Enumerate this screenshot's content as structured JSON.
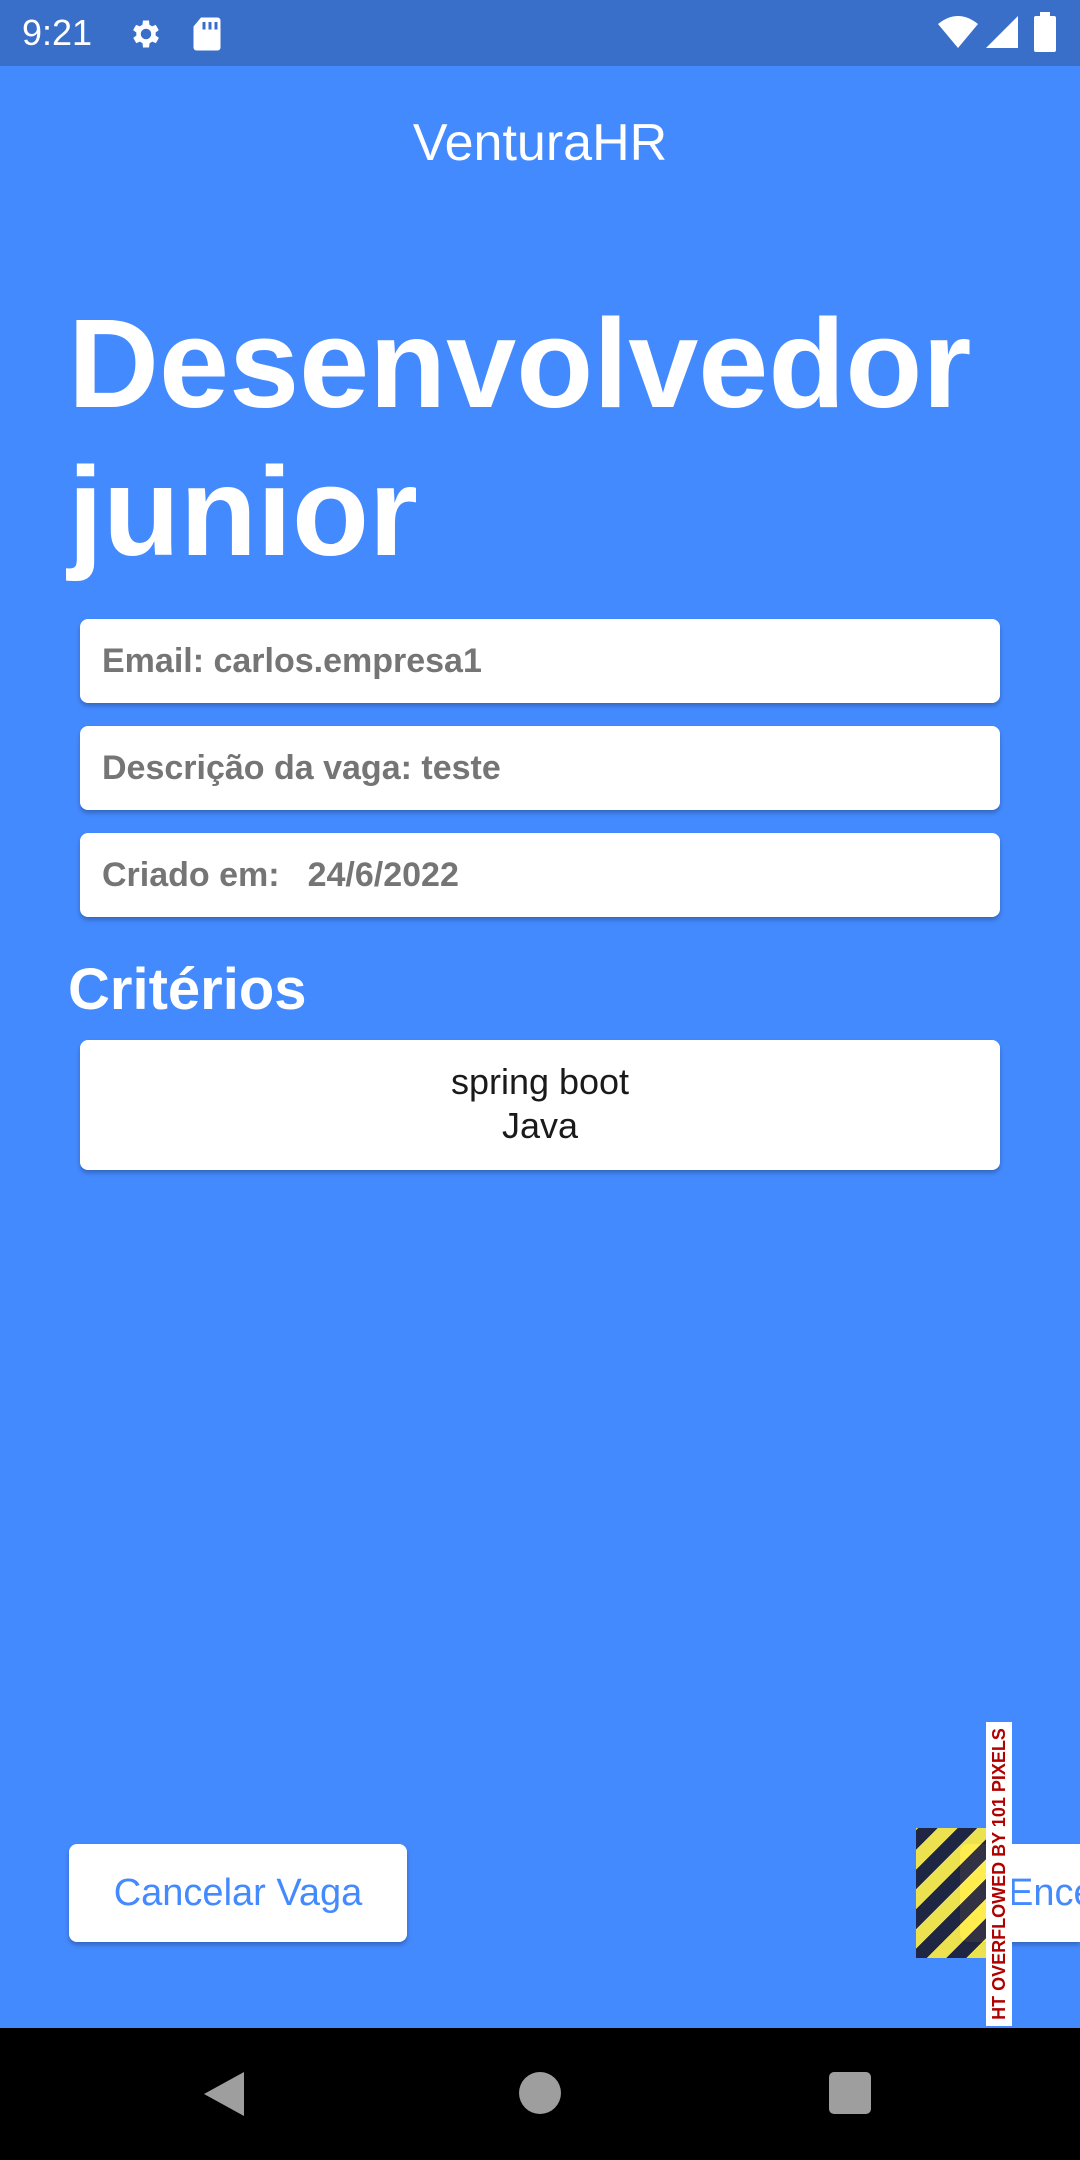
{
  "status_bar": {
    "time": "9:21",
    "icons": [
      "gear-icon",
      "sd-card-icon",
      "wifi-icon",
      "signal-icon",
      "battery-icon"
    ]
  },
  "app_bar": {
    "title": "VenturaHR"
  },
  "job": {
    "title": "Desenvolvedor junior",
    "email": "Email: carlos.empresa1",
    "description": "Descrição da vaga: teste",
    "created_label": "Criado em:",
    "created_date": "24/6/2022"
  },
  "criteria": {
    "title": "Critérios",
    "items": [
      "spring boot",
      "Java"
    ]
  },
  "actions": {
    "cancel_label": "Cancelar Vaga",
    "close_label_visible": "Ence"
  },
  "overflow_warning": {
    "text": "HT OVERFLOWED BY 101 PIXELS",
    "colors": {
      "stripe_yellow": "#ffeb3b",
      "stripe_dark": "#1b1b2f",
      "text": "#b00000"
    }
  },
  "nav_bar": {
    "icons": [
      "back-icon",
      "home-icon",
      "recents-icon"
    ]
  },
  "colors": {
    "background": "#448aff",
    "status_bar": "#3a6fc9",
    "card": "#ffffff",
    "field_text": "#757575",
    "nav_bar": "#000000"
  }
}
